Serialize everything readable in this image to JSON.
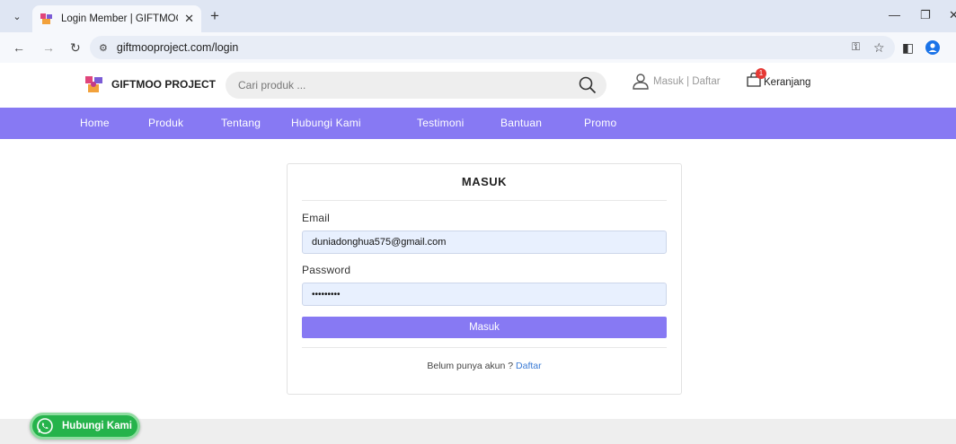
{
  "browser": {
    "tab_title": "Login Member | GIFTMOO PRO",
    "tab_close": "✕",
    "new_tab": "+",
    "url": "giftmooproject.com/login"
  },
  "header": {
    "brand": "GIFTMOO PROJECT",
    "search_placeholder": "Cari produk ...",
    "login_label": "Masuk",
    "separator": " | ",
    "register_label": "Daftar",
    "cart_label": "Keranjang",
    "cart_count": "1"
  },
  "nav": {
    "items": [
      "Home",
      "Produk",
      "Tentang",
      "Hubungi Kami",
      "Testimoni",
      "Bantuan",
      "Promo"
    ]
  },
  "login": {
    "title": "MASUK",
    "email_label": "Email",
    "email_value": "duniadonghua575@gmail.com",
    "password_label": "Password",
    "password_value": "•••••••••",
    "submit_label": "Masuk",
    "no_account_text": "Belum punya akun ? ",
    "register_link": "Daftar"
  },
  "whatsapp": {
    "label": "Hubungi Kami"
  },
  "colors": {
    "accent": "#8779f3",
    "link": "#3a7bd5",
    "whatsapp": "#25b34b",
    "badge": "#e53935"
  }
}
